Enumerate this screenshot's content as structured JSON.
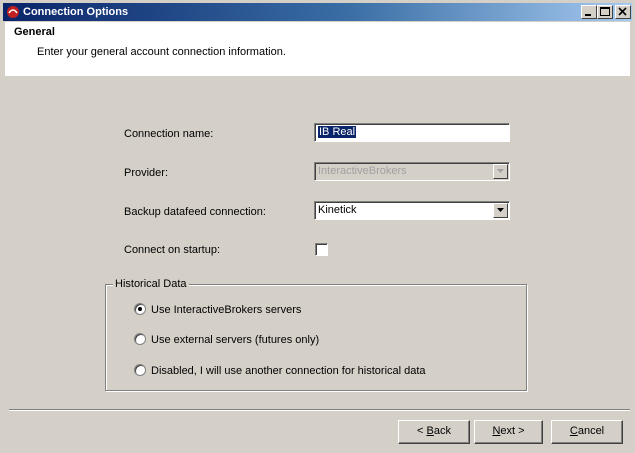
{
  "window": {
    "title": "Connection Options"
  },
  "header": {
    "title": "General",
    "subtitle": "Enter your general account connection information."
  },
  "form": {
    "connection_name": {
      "label": "Connection name:",
      "value": "IB Real"
    },
    "provider": {
      "label": "Provider:",
      "value": "InteractiveBrokers"
    },
    "backup": {
      "label": "Backup datafeed connection:",
      "value": "Kinetick"
    },
    "startup": {
      "label": "Connect on startup:",
      "checked": false
    }
  },
  "historical": {
    "legend": "Historical Data",
    "options": [
      {
        "label": "Use InteractiveBrokers servers",
        "selected": true
      },
      {
        "label": "Use external servers (futures only)",
        "selected": false
      },
      {
        "label": "Disabled, I will use another connection for historical data",
        "selected": false
      }
    ]
  },
  "buttons": {
    "back": {
      "pre": "< ",
      "key": "B",
      "post": "ack"
    },
    "next": {
      "pre": "",
      "key": "N",
      "post": "ext >"
    },
    "cancel": {
      "pre": "",
      "key": "C",
      "post": "ancel"
    }
  },
  "colors": {
    "titlebar_start": "#0a246a",
    "titlebar_end": "#a6caf0",
    "face": "#d4d0c8",
    "selection": "#0a246a"
  }
}
